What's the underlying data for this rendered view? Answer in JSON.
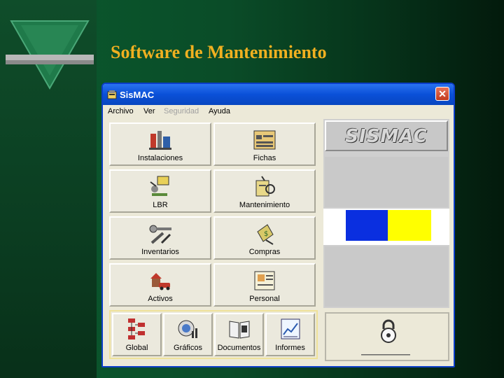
{
  "slide": {
    "title": "Software de Mantenimiento"
  },
  "window": {
    "title": "SisMAC",
    "close_symbol": "✕"
  },
  "menu": [
    "Archivo",
    "Ver",
    "Seguridad",
    "Ayuda"
  ],
  "menu_disabled": [
    "Seguridad"
  ],
  "modules": [
    {
      "label": "Instalaciones",
      "icon": "installations-icon"
    },
    {
      "label": "Fichas",
      "icon": "cards-icon"
    },
    {
      "label": "LBR",
      "icon": "lbr-icon"
    },
    {
      "label": "Mantenimiento",
      "icon": "maintenance-icon"
    },
    {
      "label": "Inventarios",
      "icon": "tools-icon"
    },
    {
      "label": "Compras",
      "icon": "purchases-icon"
    },
    {
      "label": "Activos",
      "icon": "assets-icon"
    },
    {
      "label": "Personal",
      "icon": "personnel-icon"
    }
  ],
  "bottom_buttons": [
    {
      "label": "Global",
      "icon": "org-chart-icon"
    },
    {
      "label": "Gráficos",
      "icon": "charts-icon"
    },
    {
      "label": "Documentos",
      "icon": "book-icon"
    },
    {
      "label": "Informes",
      "icon": "report-icon"
    }
  ],
  "logo": {
    "text": "SISMAC"
  },
  "colors": {
    "title": "#f0b020",
    "titlebar": "#0a50d8",
    "blue_block": "#0a2fe0",
    "yellow_block": "#ffff00"
  }
}
